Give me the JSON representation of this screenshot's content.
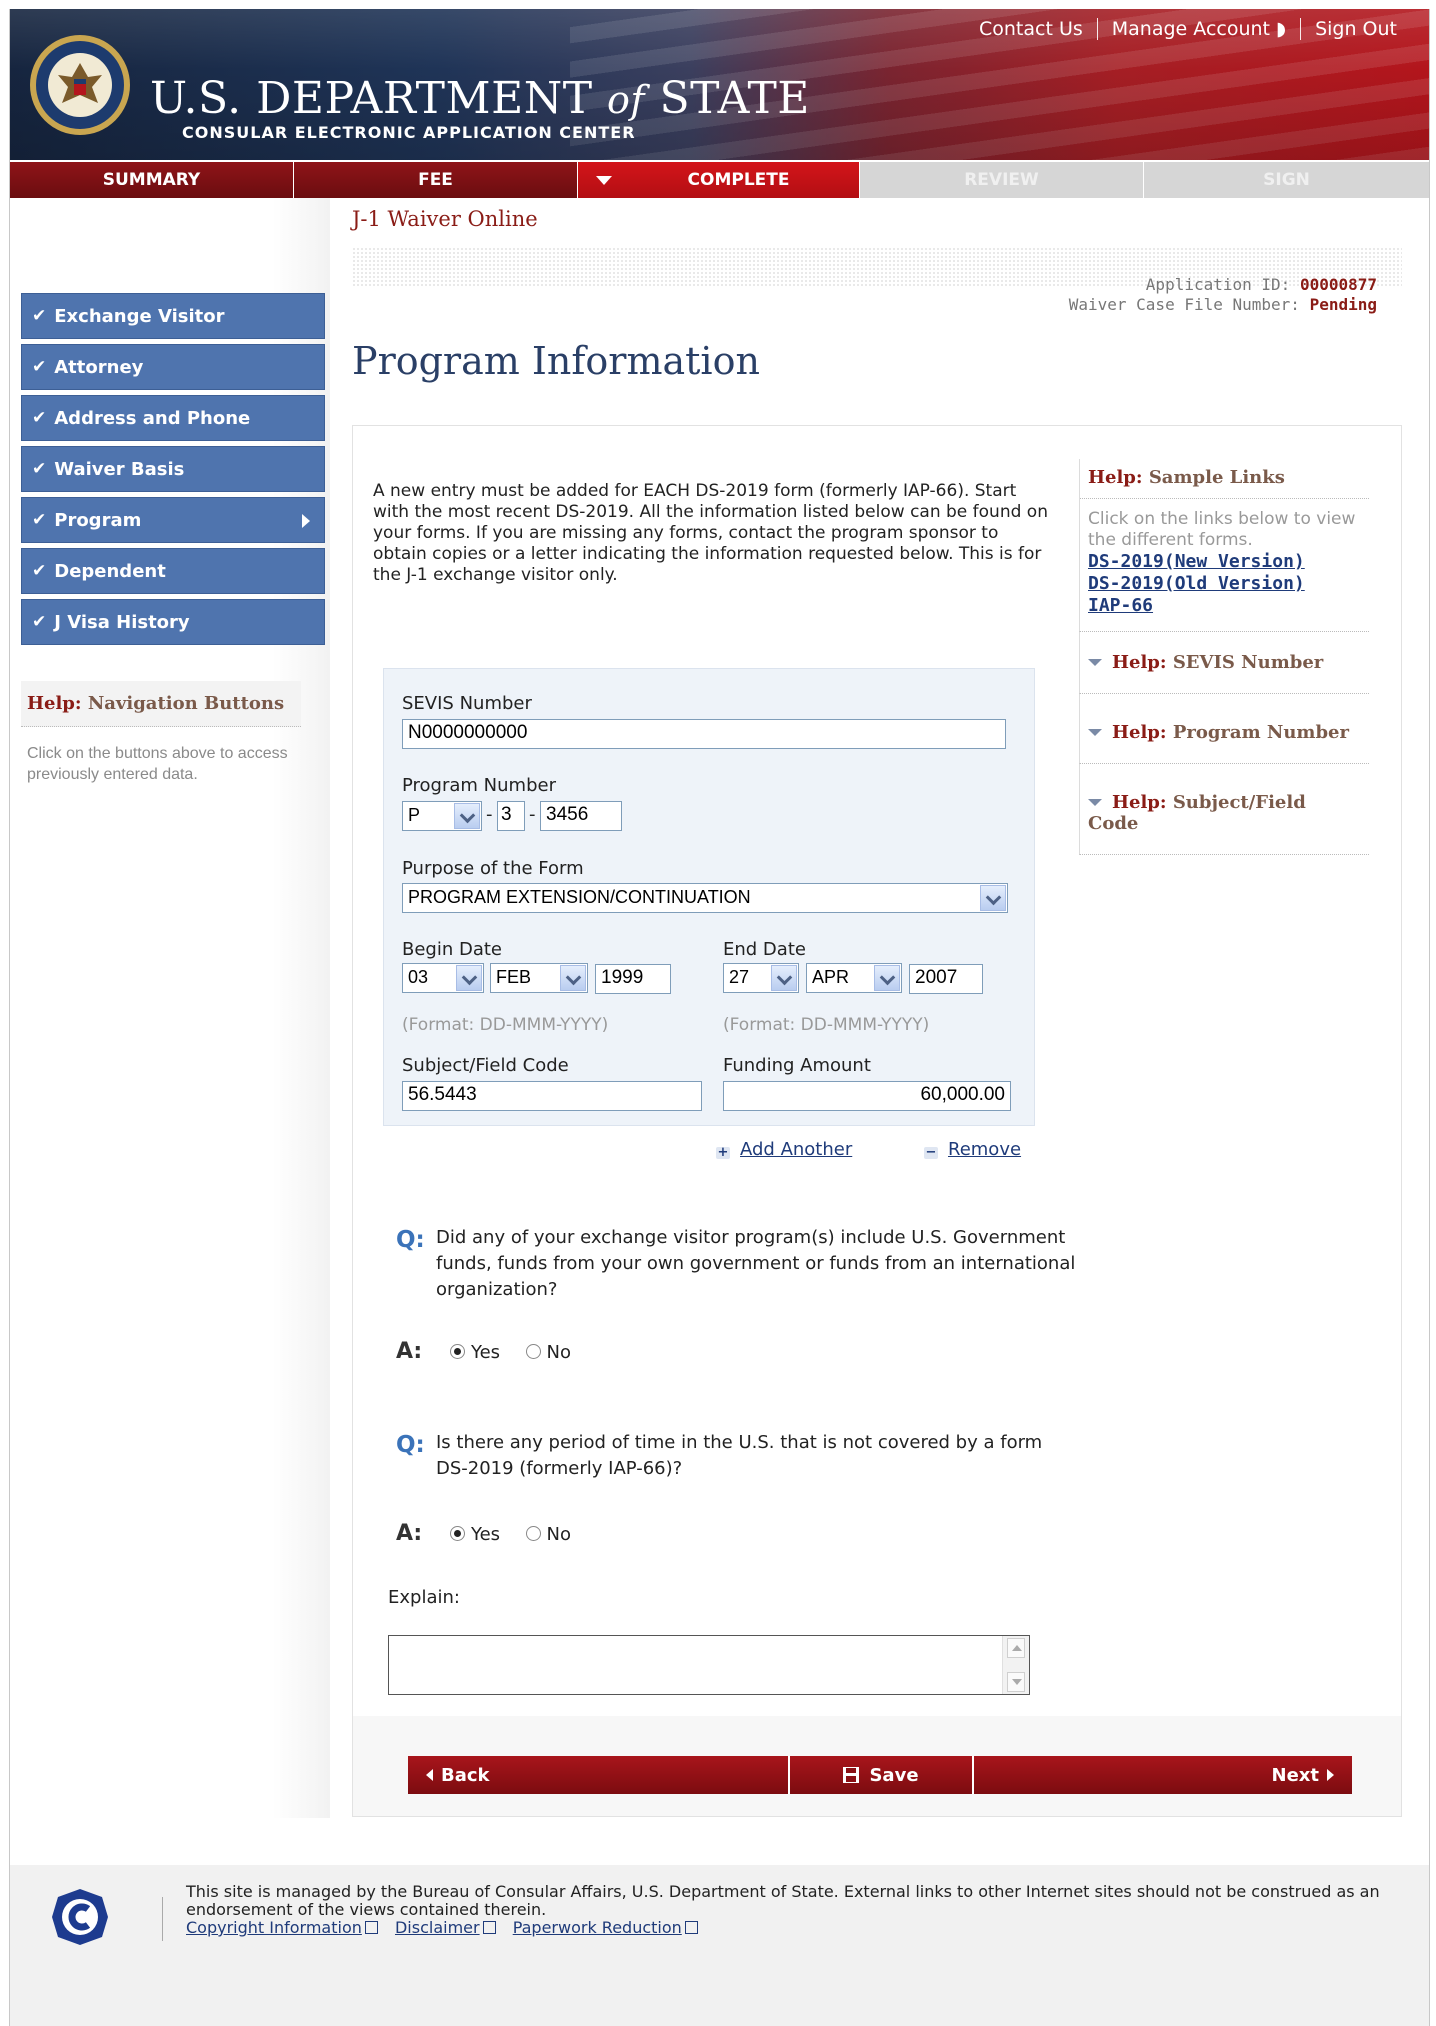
{
  "header": {
    "top_links": [
      "Contact Us",
      "Manage Account",
      "Sign Out"
    ],
    "department_title_pre": "U.S. DEPARTMENT",
    "department_title_of": "of",
    "department_title_post": "STATE",
    "department_subtitle": "CONSULAR ELECTRONIC APPLICATION CENTER"
  },
  "tabs": {
    "summary": "SUMMARY",
    "fee": "FEE",
    "complete": "COMPLETE",
    "review": "REVIEW",
    "sign": "SIGN"
  },
  "app_title": "J-1 Waiver Online",
  "application": {
    "id_label": "Application ID:",
    "id_value": "00000877",
    "case_label": "Waiver Case File Number:",
    "case_value": "Pending"
  },
  "page_title": "Program Information",
  "sidebar": {
    "items": [
      {
        "label": "Exchange Visitor"
      },
      {
        "label": "Attorney"
      },
      {
        "label": "Address and Phone"
      },
      {
        "label": "Waiver Basis"
      },
      {
        "label": "Program"
      },
      {
        "label": "Dependent"
      },
      {
        "label": "J Visa History"
      }
    ],
    "help_prefix": "Help:",
    "help_title": "Navigation Buttons",
    "help_body": "Click on the buttons above to access previously entered data."
  },
  "intro": "A new entry must be added for EACH DS-2019 form (formerly IAP-66). Start with the most recent DS-2019. All the information listed below can be found on your forms. If you are missing any forms, contact the program sponsor to obtain copies or a letter indicating the information requested below. This is for the J-1 exchange visitor only.",
  "form": {
    "sevis_label": "SEVIS Number",
    "sevis_value": "N0000000000",
    "program_label": "Program Number",
    "program_prefix": "P",
    "program_mid": "3",
    "program_num": "3456",
    "purpose_label": "Purpose of the Form",
    "purpose_value": "PROGRAM EXTENSION/CONTINUATION",
    "begin_label": "Begin Date",
    "begin_day": "03",
    "begin_month": "FEB",
    "begin_year": "1999",
    "end_label": "End Date",
    "end_day": "27",
    "end_month": "APR",
    "end_year": "2007",
    "format_hint": "(Format: DD-MMM-YYYY)",
    "subject_label": "Subject/Field Code",
    "subject_value": "56.5443",
    "funding_label": "Funding Amount",
    "funding_value": "60,000.00",
    "add_another": "Add Another",
    "remove": "Remove"
  },
  "questions": [
    {
      "q_mark": "Q:",
      "text": "Did any of your exchange visitor program(s) include U.S. Government funds, funds from your own government or funds from an international organization?",
      "a_mark": "A:",
      "yes": "Yes",
      "no": "No",
      "selected": "Yes"
    },
    {
      "q_mark": "Q:",
      "text": "Is there any period of time in the U.S. that is not covered by a form DS-2019 (formerly IAP-66)?",
      "a_mark": "A:",
      "yes": "Yes",
      "no": "No",
      "selected": "Yes"
    }
  ],
  "explain_label": "Explain:",
  "buttons": {
    "back": "Back",
    "save": "Save",
    "next": "Next"
  },
  "right_help": {
    "prefix": "Help:",
    "sample_title": "Sample Links",
    "sample_body": "Click on the links below to view the different forms.",
    "links": [
      "DS-2019(New Version)",
      "DS-2019(Old Version)",
      "IAP-66"
    ],
    "sevis_title": "SEVIS Number",
    "program_title": "Program Number",
    "subject_title": "Subject/Field Code"
  },
  "footer": {
    "text": "This site is managed by the Bureau of Consular Affairs, U.S. Department of State. External links to other Internet sites should not be construed as an endorsement of the views contained therein.",
    "links": [
      "Copyright Information",
      "Disclaimer",
      "Paperwork Reduction"
    ]
  },
  "colors": {
    "brand_red": "#a51e24",
    "nav_blue": "#4f74ae",
    "link_blue": "#1f3b7a",
    "title_blue": "#2a3f66"
  }
}
